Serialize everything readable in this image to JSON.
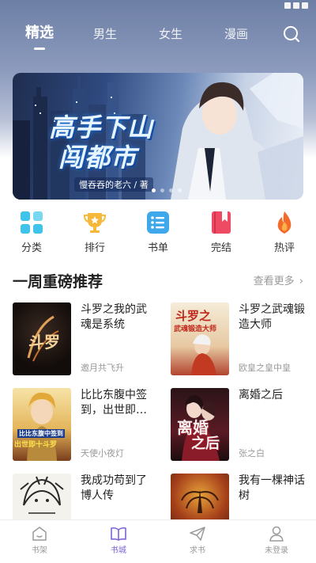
{
  "top_tabs": [
    {
      "label": "精选",
      "active": true
    },
    {
      "label": "男生",
      "active": false
    },
    {
      "label": "女生",
      "active": false
    },
    {
      "label": "漫画",
      "active": false
    }
  ],
  "search_icon": "search-icon",
  "banner": {
    "title_line1": "高手下山",
    "title_line2": "闯都市",
    "author": "慢吞吞的老六 / 著",
    "slide_count": 4,
    "active_slide": 1
  },
  "quick_nav": [
    {
      "label": "分类",
      "icon": "category-icon",
      "color": "#3fc3ea"
    },
    {
      "label": "排行",
      "icon": "trophy-icon",
      "color": "#f5b83a"
    },
    {
      "label": "书单",
      "icon": "list-icon",
      "color": "#3fa8ea"
    },
    {
      "label": "完结",
      "icon": "book-finished-icon",
      "color": "#ef4a63"
    },
    {
      "label": "热评",
      "icon": "flame-icon",
      "color": "#f26b2a"
    }
  ],
  "weekly": {
    "title": "一周重磅推荐",
    "more_label": "查看更多"
  },
  "books": [
    {
      "title": "斗罗之我的武魂是系统",
      "author": "邀月共飞升",
      "cover_text": "斗罗"
    },
    {
      "title": "斗罗之武魂锻造大师",
      "author": "欧皇之皇中皇",
      "cover_text": "斗罗之",
      "cover_text2": "武魂锻造大师"
    },
    {
      "title": "比比东腹中签到，出世即…",
      "author": "天使小夜灯",
      "cover_text": "比比东腹中签到",
      "cover_text2": "出世即十斗罗"
    },
    {
      "title": "离婚之后",
      "author": "张之白",
      "cover_text": "离婚",
      "cover_text2": "之后"
    },
    {
      "title": "我成功苟到了博人传",
      "author": "",
      "cover_text": ""
    },
    {
      "title": "我有一棵神话树",
      "author": "",
      "cover_text": ""
    }
  ],
  "bottom_nav": [
    {
      "label": "书架",
      "icon": "bookshelf-icon",
      "active": false
    },
    {
      "label": "书城",
      "icon": "open-book-icon",
      "active": true
    },
    {
      "label": "求书",
      "icon": "paper-plane-icon",
      "active": false
    },
    {
      "label": "未登录",
      "icon": "user-icon",
      "active": false
    }
  ],
  "colors": {
    "accent": "#7b63d8",
    "header_top": "#6e7fa6",
    "text_primary": "#222222",
    "text_secondary": "#999999"
  }
}
